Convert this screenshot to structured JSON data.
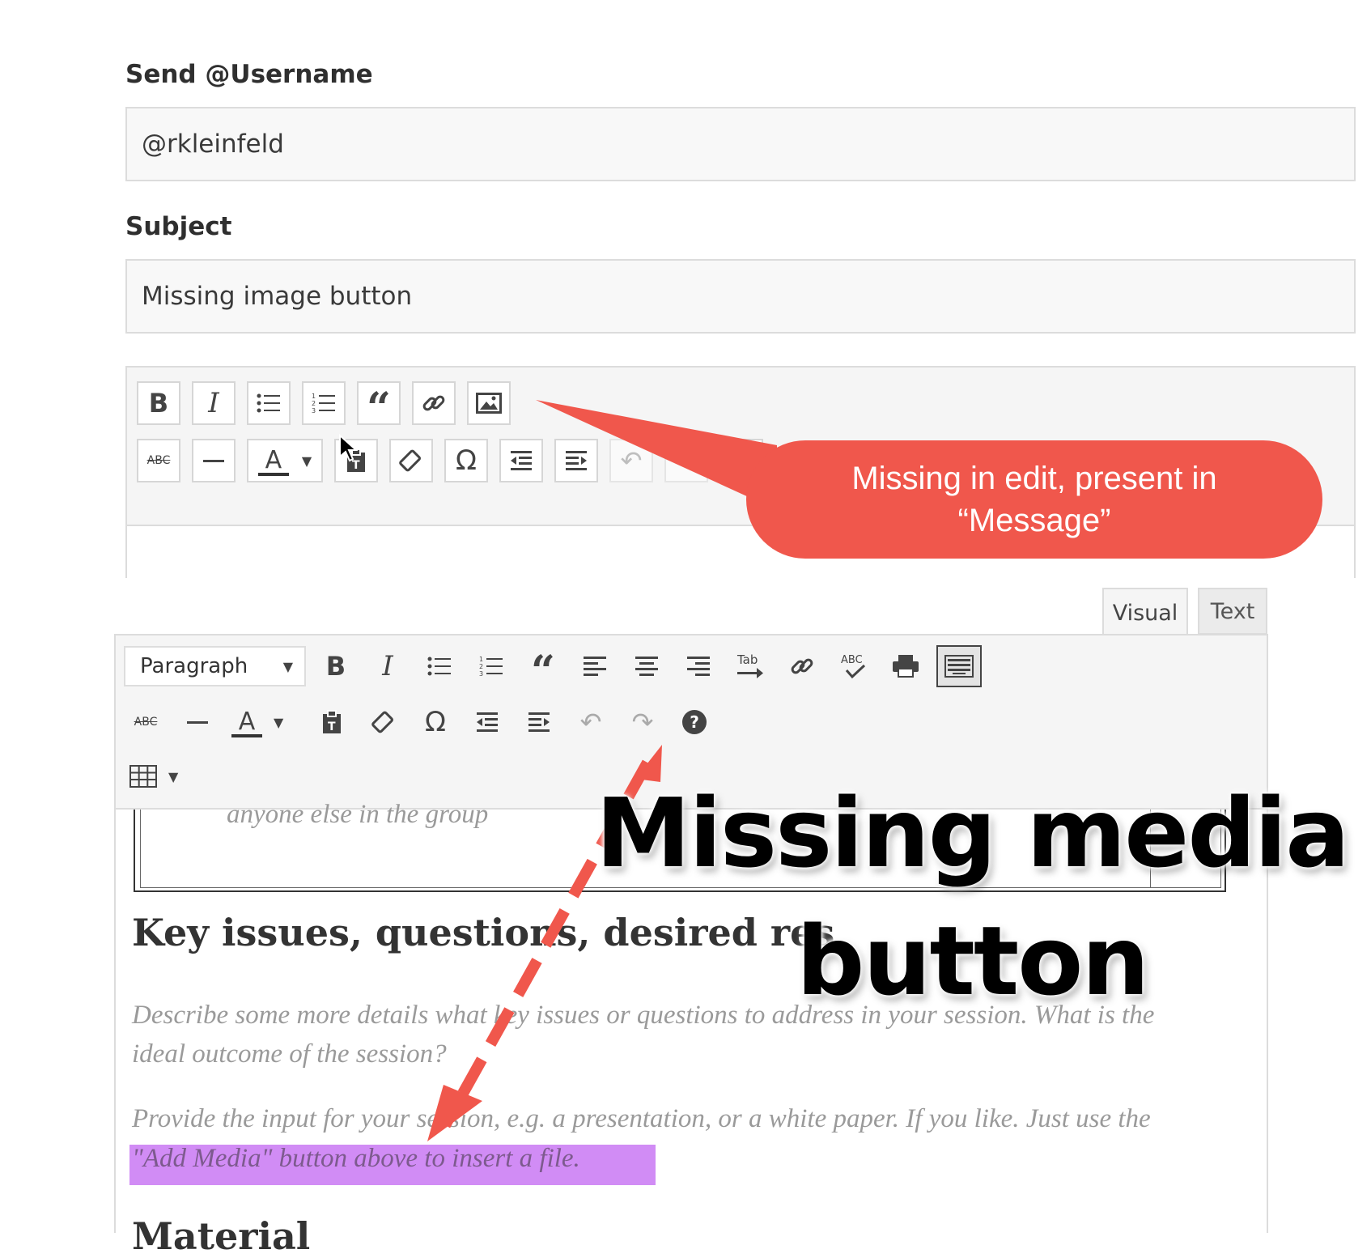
{
  "form": {
    "username_label": "Send @Username",
    "username_value": "@rkleinfeld",
    "subject_label": "Subject",
    "subject_value": "Missing image button"
  },
  "editor_tabs": {
    "visual": "Visual",
    "text": "Text"
  },
  "format_select": {
    "selected": "Paragraph"
  },
  "editor_content": {
    "table_text": "anyone else in the group",
    "heading1": "Key issues, questions, desired res",
    "para1_line1": "Describe some more details what key issues or questions to address in your session. What is the",
    "para1_line2": "ideal outcome of the session?",
    "para2_line1": "Provide the input for your session, e.g. a presentation, or a white paper. If you like. Just use the",
    "para2_line2": "\"Add Media\" button above to insert a file.",
    "heading2": "Material"
  },
  "annotations": {
    "bubble_line1": "Missing in edit, present in",
    "bubble_line2": "“Message”",
    "big_line1": "Missing media",
    "big_line2": "button",
    "bubble_color": "#f0574c",
    "highlight_color": "#d18cf5"
  }
}
